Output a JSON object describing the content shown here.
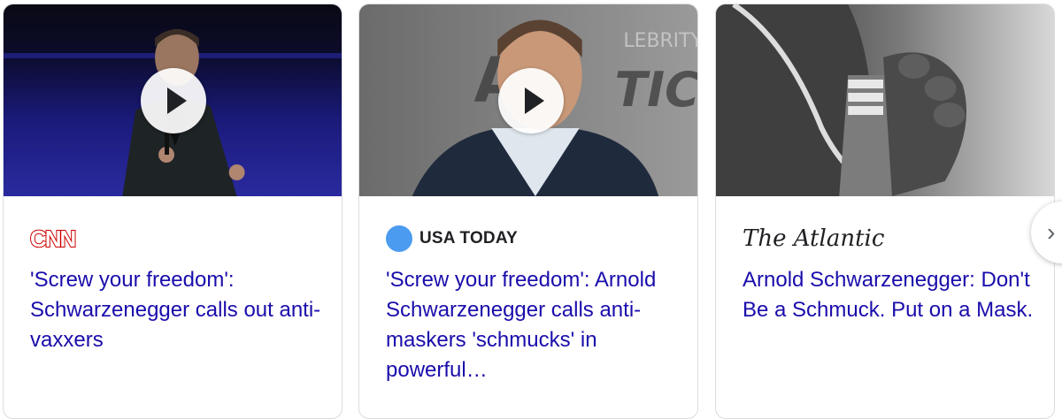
{
  "cards": [
    {
      "source": "CNN",
      "title": "'Screw your freedom': Schwarzenegger calls out anti-vaxxers",
      "has_video": true
    },
    {
      "source": "USA TODAY",
      "title": "'Screw your freedom': Arnold Schwarzenegger calls anti-maskers 'schmucks' in powerful…",
      "has_video": true
    },
    {
      "source": "The Atlantic",
      "title": "Arnold Schwarzenegger: Don't Be a Schmuck. Put on a Mask.",
      "has_video": false
    }
  ],
  "next_button": {
    "icon": "chevron-right-icon",
    "label": "›"
  },
  "colors": {
    "title_link": "#1a0dab",
    "cnn_red": "#cc0000",
    "usa_today_blue": "#4b9cf0",
    "border": "#dadce0"
  }
}
